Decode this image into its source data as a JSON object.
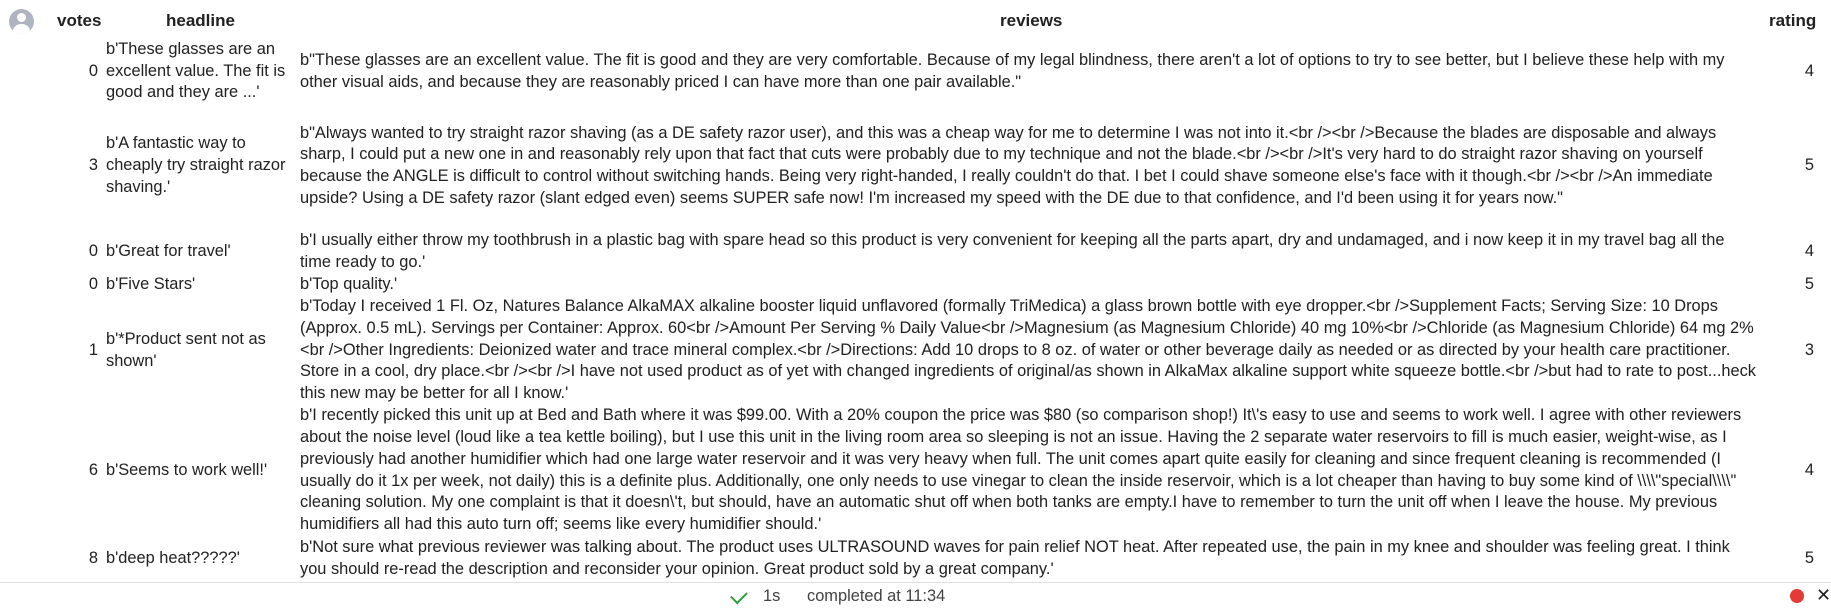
{
  "table": {
    "columns": {
      "votes": "votes",
      "headline": "headline",
      "reviews": "reviews",
      "rating": "rating"
    },
    "rows": [
      {
        "votes": "0",
        "headline": "b'These glasses are an excellent value. The fit is good and they are ...'",
        "review": "b\"These glasses are an excellent value. The fit is good and they are very comfortable. Because of my legal blindness, there aren't a lot of options to try to see better, but I believe these help with my other visual aids, and because they are reasonably priced I can have more than one pair available.\"",
        "rating": "4"
      },
      {
        "votes": "3",
        "headline": "b'A fantastic way to cheaply try straight razor shaving.'",
        "review": "b\"Always wanted to try straight razor shaving (as a DE safety razor user), and this was a cheap way for me to determine I was not into it.<br /><br />Because the blades are disposable and always sharp, I could put a new one in and reasonably rely upon that fact that cuts were probably due to my technique and not the blade.<br /><br />It's very hard to do straight razor shaving on yourself because the ANGLE is difficult to control without switching hands. Being very right-handed, I really couldn't do that. I bet I could shave someone else's face with it though.<br /><br />An immediate upside? Using a DE safety razor (slant edged even) seems SUPER safe now! I'm increased my speed with the DE due to that confidence, and I'd been using it for years now.\"",
        "rating": "5"
      },
      {
        "votes": "0",
        "headline": "b'Great for travel'",
        "review": "b'I usually either throw my toothbrush in a plastic bag with spare head so this product is very convenient for keeping all the parts apart, dry and undamaged, and i now keep it in my travel bag all the time ready to go.'",
        "rating": "4"
      },
      {
        "votes": "0",
        "headline": "b'Five Stars'",
        "review": "b'Top quality.'",
        "rating": "5"
      },
      {
        "votes": "1",
        "headline": "b'*Product sent not as shown'",
        "review": "b'Today I received 1 Fl. Oz, Natures Balance AlkaMAX alkaline booster liquid unflavored (formally TriMedica) a glass brown bottle with eye dropper.<br />Supplement Facts; Serving Size: 10 Drops (Approx. 0.5 mL). Servings per Container: Approx. 60<br />Amount Per Serving % Daily Value<br />Magnesium (as Magnesium Chloride) 40 mg 10%<br />Chloride (as Magnesium Chloride) 64 mg 2%<br />Other Ingredients: Deionized water and trace mineral complex.<br />Directions: Add 10 drops to 8 oz. of water or other beverage daily as needed or as directed by your health care practitioner. Store in a cool, dry place.<br /><br />I have not used product as of yet with changed ingredients of original/as shown in AlkaMax alkaline support white squeeze bottle.<br />but had to rate to post...heck this new may be better for all I know.'",
        "rating": "3"
      },
      {
        "votes": "6",
        "headline": "b'Seems to work well!'",
        "review": "b'I recently picked this unit up at Bed and Bath where it was $99.00. With a 20% coupon the price was $80 (so comparison shop!) It\\'s easy to use and seems to work well. I agree with other reviewers about the noise level (loud like a tea kettle boiling), but I use this unit in the living room area so sleeping is not an issue. Having the 2 separate water reservoirs to fill is much easier, weight-wise, as I previously had another humidifier which had one large water reservoir and it was very heavy when full. The unit comes apart quite easily for cleaning and since frequent cleaning is recommended (I usually do it 1x per week, not daily) this is a definite plus. Additionally, one only needs to use vinegar to clean the inside reservoir, which is a lot cheaper than having to buy some kind of \\\\\\\\\"special\\\\\\\\\" cleaning solution. My one complaint is that it doesn\\'t, but should, have an automatic shut off when both tanks are empty.I have to remember to turn the unit off when I leave the house. My previous humidifiers all had this auto turn off; seems like every humidifier should.'",
        "rating": "4"
      },
      {
        "votes": "8",
        "headline": "b'deep heat?????'",
        "review": "b'Not sure what previous reviewer was talking about. The product uses ULTRASOUND waves for pain relief NOT heat. After repeated use, the pain in my knee and shoulder was feeling great. I think you should re-read the description and reconsider your opinion. Great product sold by a great company.'",
        "rating": "5"
      }
    ]
  },
  "status": {
    "duration": "1s",
    "completed": "completed at 11:34",
    "colors": {
      "check": "#2e9e3e",
      "indicator": "#e53935"
    },
    "icons": [
      "check-icon",
      "status-dot-icon",
      "close-icon"
    ]
  }
}
